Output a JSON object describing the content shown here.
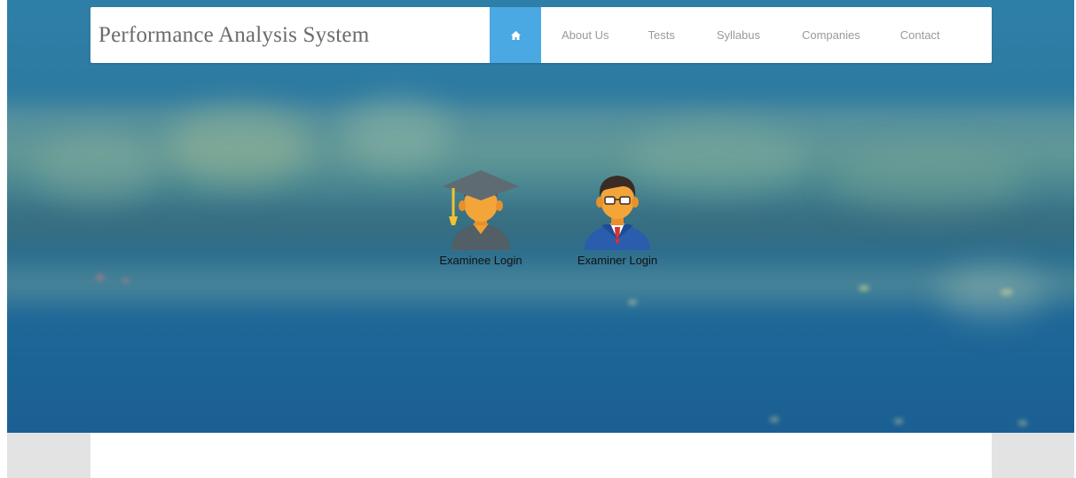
{
  "navbar": {
    "brand": "Performance Analysis System",
    "home_icon": "home-icon",
    "links": [
      {
        "label": "About Us"
      },
      {
        "label": "Tests"
      },
      {
        "label": "Syllabus"
      },
      {
        "label": "Companies"
      },
      {
        "label": "Contact"
      }
    ]
  },
  "hero": {
    "background": "blurred-city-skyline-photo",
    "logins": [
      {
        "label": "Examinee Login",
        "icon": "graduate-student-icon"
      },
      {
        "label": "Examiner Login",
        "icon": "teacher-icon"
      }
    ]
  },
  "colors": {
    "accent": "#4aa8e2",
    "brand_text": "#6b6b6b",
    "nav_text": "#9a9a9a"
  }
}
